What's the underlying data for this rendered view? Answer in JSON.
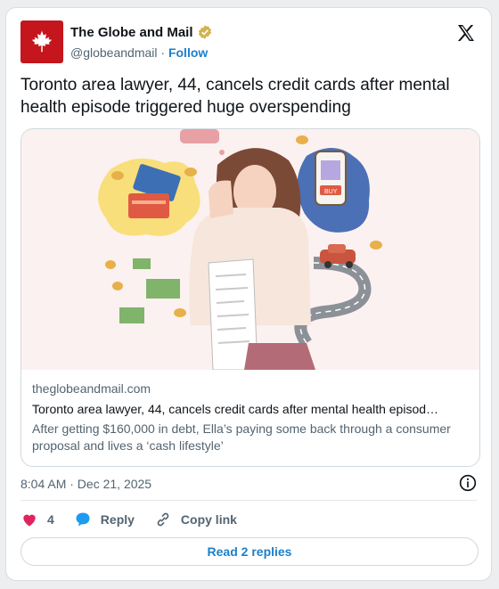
{
  "author": {
    "name": "The Globe and Mail",
    "handle": "@globeandmail",
    "separator": "·",
    "follow_label": "Follow"
  },
  "tweet": {
    "text": "Toronto area lawyer, 44, cancels credit cards after mental health episode triggered huge overspending"
  },
  "link_card": {
    "domain": "theglobeandmail.com",
    "title": "Toronto area lawyer, 44, cancels credit cards after mental health episod…",
    "description": "After getting $160,000 in debt, Ella’s paying some back through a consumer proposal and lives a ‘cash lifestyle’",
    "illustration_text": "BUY"
  },
  "meta": {
    "timestamp": "8:04 AM · Dec 21, 2025"
  },
  "actions": {
    "like_count": "4",
    "reply_label": "Reply",
    "copy_link_label": "Copy link"
  },
  "footer": {
    "read_replies_label": "Read 2 replies"
  },
  "colors": {
    "brand_red": "#c4161c",
    "link_blue": "#1d7fc9",
    "like_pink": "#e0245e",
    "verified_gold": "#d4b24c"
  },
  "icons": [
    "maple-leaf-icon",
    "verified-badge-icon",
    "x-logo-icon",
    "info-icon",
    "heart-icon",
    "reply-bubble-icon",
    "link-icon"
  ]
}
